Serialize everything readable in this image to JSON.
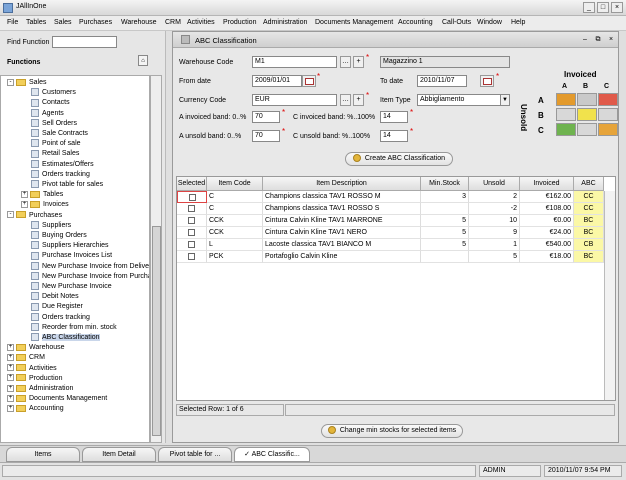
{
  "app": {
    "title": "JAllInOne"
  },
  "menu": [
    "File",
    "Tables",
    "Sales",
    "Purchases",
    "Warehouse",
    "CRM",
    "Activities",
    "Production",
    "Administration",
    "Documents Management",
    "Accounting",
    "Call-Outs",
    "Window",
    "Help"
  ],
  "left": {
    "find_label": "Find Function",
    "functions_label": "Functions",
    "tree": [
      {
        "label": "Sales",
        "level": 0,
        "type": "folder",
        "exp": "-"
      },
      {
        "label": "Customers",
        "level": 1,
        "type": "leaf"
      },
      {
        "label": "Contacts",
        "level": 1,
        "type": "leaf"
      },
      {
        "label": "Agents",
        "level": 1,
        "type": "leaf"
      },
      {
        "label": "Sell Orders",
        "level": 1,
        "type": "leaf"
      },
      {
        "label": "Sale Contracts",
        "level": 1,
        "type": "leaf"
      },
      {
        "label": "Point of sale",
        "level": 1,
        "type": "leaf"
      },
      {
        "label": "Retail Sales",
        "level": 1,
        "type": "leaf"
      },
      {
        "label": "Estimates/Offers",
        "level": 1,
        "type": "leaf"
      },
      {
        "label": "Orders tracking",
        "level": 1,
        "type": "leaf"
      },
      {
        "label": "Pivot table for sales",
        "level": 1,
        "type": "leaf"
      },
      {
        "label": "Tables",
        "level": 1,
        "type": "folder",
        "exp": "+"
      },
      {
        "label": "Invoices",
        "level": 1,
        "type": "folder",
        "exp": "+"
      },
      {
        "label": "Purchases",
        "level": 0,
        "type": "folder",
        "exp": "-"
      },
      {
        "label": "Suppliers",
        "level": 1,
        "type": "leaf"
      },
      {
        "label": "Buying Orders",
        "level": 1,
        "type": "leaf"
      },
      {
        "label": "Suppliers Hierarchies",
        "level": 1,
        "type": "leaf"
      },
      {
        "label": "Purchase Invoices List",
        "level": 1,
        "type": "leaf"
      },
      {
        "label": "New Purchase Invoice from Delivery",
        "level": 1,
        "type": "leaf"
      },
      {
        "label": "New Purchase Invoice from Purchase",
        "level": 1,
        "type": "leaf"
      },
      {
        "label": "New Purchase Invoice",
        "level": 1,
        "type": "leaf"
      },
      {
        "label": "Debit Notes",
        "level": 1,
        "type": "leaf"
      },
      {
        "label": "Due Register",
        "level": 1,
        "type": "leaf"
      },
      {
        "label": "Orders tracking",
        "level": 1,
        "type": "leaf"
      },
      {
        "label": "Reorder from min. stock",
        "level": 1,
        "type": "leaf"
      },
      {
        "label": "ABC Classification",
        "level": 1,
        "type": "leaf",
        "selected": true
      },
      {
        "label": "Warehouse",
        "level": 0,
        "type": "folder",
        "exp": "+"
      },
      {
        "label": "CRM",
        "level": 0,
        "type": "folder",
        "exp": "+"
      },
      {
        "label": "Activities",
        "level": 0,
        "type": "folder",
        "exp": "+"
      },
      {
        "label": "Production",
        "level": 0,
        "type": "folder",
        "exp": "+"
      },
      {
        "label": "Administration",
        "level": 0,
        "type": "folder",
        "exp": "+"
      },
      {
        "label": "Documents Management",
        "level": 0,
        "type": "folder",
        "exp": "+"
      },
      {
        "label": "Accounting",
        "level": 0,
        "type": "folder",
        "exp": "+"
      }
    ]
  },
  "frame": {
    "title": "ABC Classification",
    "warehouse_code_label": "Warehouse Code",
    "warehouse_code": "M1",
    "warehouse_desc": "Magazzino 1",
    "from_date_label": "From date",
    "from_date": "2009/01/01",
    "to_date_label": "To date",
    "to_date": "2010/11/07",
    "currency_label": "Currency Code",
    "currency": "EUR",
    "item_type_label": "Item Type",
    "item_type": "Abbigliamento",
    "a_inv_label": "A invoiced band: 0..%",
    "a_inv": "70",
    "c_inv_label": "C invoiced band: %..100%",
    "c_inv": "14",
    "a_uns_label": "A unsold band: 0..%",
    "a_uns": "70",
    "c_uns_label": "C unsold band: %..100%",
    "c_uns": "14",
    "create_btn": "Create ABC Classification",
    "change_btn": "Change min stocks for selected items",
    "selected_row": "Selected Row: 1 of 6"
  },
  "matrix": {
    "title_top": "Invoiced",
    "title_side": "Unsold",
    "cols": [
      "A",
      "B",
      "C"
    ],
    "rows": [
      "A",
      "B",
      "C"
    ],
    "colors": [
      [
        "#e39a2c",
        "#c9c9c9",
        "#e05a4a"
      ],
      [
        "#d8d8d8",
        "#f1e24c",
        "#d8d8d8"
      ],
      [
        "#6fb34f",
        "#d8d8d8",
        "#e6a43a"
      ]
    ]
  },
  "table": {
    "headers": [
      "Selected",
      "Item Code",
      "Item Description",
      "Min.Stock",
      "Unsold",
      "Invoiced",
      "ABC"
    ],
    "rows": [
      [
        "",
        "C",
        "Champions classica TAV1 ROSSO M",
        "3",
        "2",
        "€162.00",
        "CC"
      ],
      [
        "",
        "C",
        "Champions classica TAV1 ROSSO S",
        "",
        "-2",
        "€108.00",
        "CC"
      ],
      [
        "",
        "CCK",
        "Cintura Calvin Kline TAV1 MARRONE",
        "5",
        "10",
        "€0.00",
        "BC"
      ],
      [
        "",
        "CCK",
        "Cintura Calvin Kline TAV1 NERO",
        "5",
        "9",
        "€24.00",
        "BC"
      ],
      [
        "",
        "L",
        "Lacoste classica TAV1 BIANCO M",
        "5",
        "1",
        "€540.00",
        "CB"
      ],
      [
        "",
        "PCK",
        "Portafoglio Calvin Kline",
        "",
        "5",
        "€18.00",
        "BC"
      ]
    ]
  },
  "tabs": [
    "Items",
    "Item Detail",
    "Pivot table for ...",
    "ABC Classific..."
  ],
  "status": {
    "user": "ADMIN",
    "datetime": "2010/11/07 9:54 PM"
  }
}
